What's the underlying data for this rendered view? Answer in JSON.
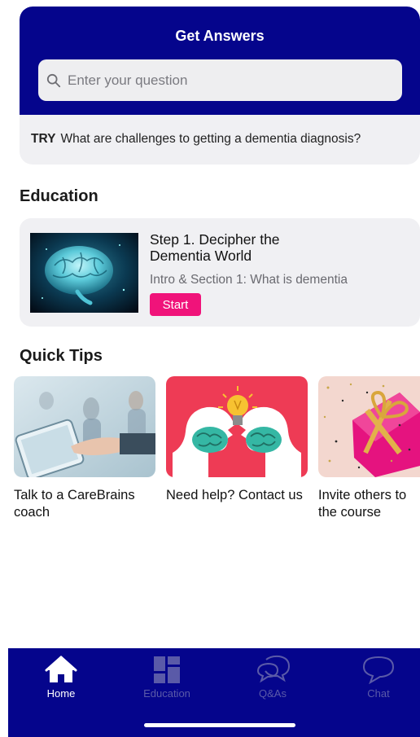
{
  "get_answers": {
    "title": "Get Answers",
    "search_placeholder": "Enter your question",
    "try_prefix": "TRY",
    "try_text": "What are challenges to getting a dementia diagnosis?"
  },
  "education": {
    "section_title": "Education",
    "card": {
      "title": "Step 1. Decipher the Dementia World",
      "subtitle": "Intro & Section 1: What is dementia",
      "button_label": "Start",
      "button_color": "#f0137a"
    }
  },
  "quick_tips": {
    "section_title": "Quick Tips",
    "items": [
      {
        "label": "Talk to a CareBrains coach",
        "icon": "tablet-coach-photo"
      },
      {
        "label": "Need help? Contact us",
        "icon": "brains-lightbulb-illustration"
      },
      {
        "label": "Invite others to the course",
        "icon": "gift-box-photo"
      }
    ]
  },
  "tabbar": {
    "color": "#05058c",
    "tabs": [
      {
        "label": "Home",
        "icon": "home-icon",
        "active": true
      },
      {
        "label": "Education",
        "icon": "dashboard-icon",
        "active": false
      },
      {
        "label": "Q&As",
        "icon": "chat-bubbles-icon",
        "active": false
      },
      {
        "label": "Chat",
        "icon": "chat-bubble-icon",
        "active": false
      }
    ]
  }
}
